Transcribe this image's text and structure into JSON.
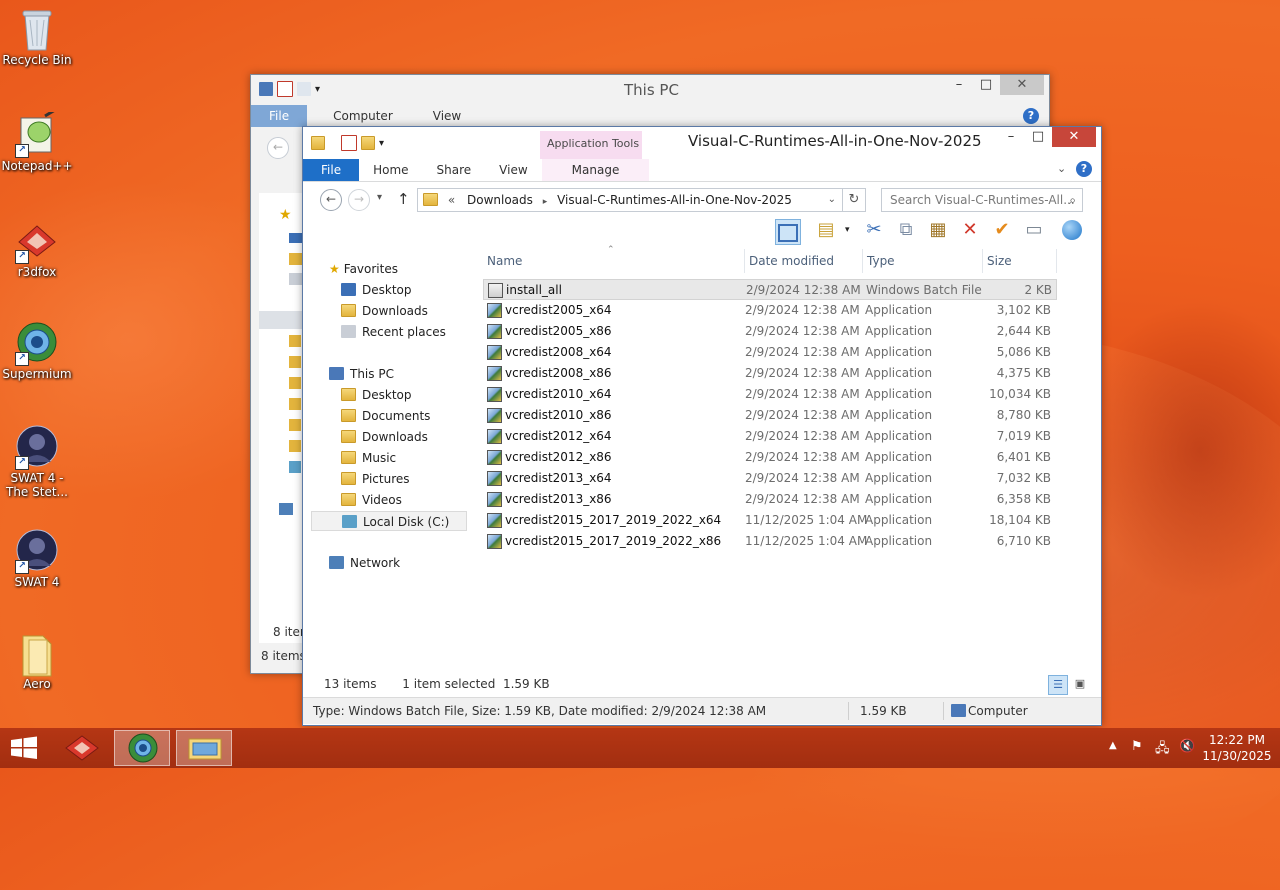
{
  "desktop": {
    "icons": [
      {
        "label": "Recycle Bin",
        "icon": "recycle-bin-icon"
      },
      {
        "label": "Notepad++",
        "icon": "notepad-plus-plus-icon"
      },
      {
        "label": "r3dfox",
        "icon": "r3dfox-icon"
      },
      {
        "label": "Supermium",
        "icon": "supermium-icon"
      },
      {
        "label": "SWAT 4 - The Stet...",
        "icon": "swat4-stetchkov-icon"
      },
      {
        "label": "SWAT 4",
        "icon": "swat4-icon"
      },
      {
        "label": "Aero",
        "icon": "folder-icon"
      }
    ]
  },
  "back_window": {
    "title": "This PC",
    "tabs": [
      "File",
      "Computer",
      "View"
    ],
    "status_items": "8 items",
    "status_items_2": "8 items"
  },
  "front_window": {
    "title": "Visual-C-Runtimes-All-in-One-Nov-2025",
    "contextual_group": "Application Tools",
    "tabs": [
      "File",
      "Home",
      "Share",
      "View",
      "Manage"
    ],
    "address": {
      "prefix": "«",
      "crumbs": [
        "Downloads",
        "Visual-C-Runtimes-All-in-One-Nov-2025"
      ]
    },
    "search_placeholder": "Search Visual-C-Runtimes-All...",
    "nav": {
      "favorites": "Favorites",
      "fav_items": [
        "Desktop",
        "Downloads",
        "Recent places"
      ],
      "this_pc": "This PC",
      "pc_items": [
        "Desktop",
        "Documents",
        "Downloads",
        "Music",
        "Pictures",
        "Videos",
        "Local Disk (C:)"
      ],
      "network": "Network"
    },
    "columns": {
      "name": "Name",
      "date": "Date modified",
      "type": "Type",
      "size": "Size"
    },
    "files": [
      {
        "name": "install_all",
        "date": "2/9/2024 12:38 AM",
        "type": "Windows Batch File",
        "size": "2 KB"
      },
      {
        "name": "vcredist2005_x64",
        "date": "2/9/2024 12:38 AM",
        "type": "Application",
        "size": "3,102 KB"
      },
      {
        "name": "vcredist2005_x86",
        "date": "2/9/2024 12:38 AM",
        "type": "Application",
        "size": "2,644 KB"
      },
      {
        "name": "vcredist2008_x64",
        "date": "2/9/2024 12:38 AM",
        "type": "Application",
        "size": "5,086 KB"
      },
      {
        "name": "vcredist2008_x86",
        "date": "2/9/2024 12:38 AM",
        "type": "Application",
        "size": "4,375 KB"
      },
      {
        "name": "vcredist2010_x64",
        "date": "2/9/2024 12:38 AM",
        "type": "Application",
        "size": "10,034 KB"
      },
      {
        "name": "vcredist2010_x86",
        "date": "2/9/2024 12:38 AM",
        "type": "Application",
        "size": "8,780 KB"
      },
      {
        "name": "vcredist2012_x64",
        "date": "2/9/2024 12:38 AM",
        "type": "Application",
        "size": "7,019 KB"
      },
      {
        "name": "vcredist2012_x86",
        "date": "2/9/2024 12:38 AM",
        "type": "Application",
        "size": "6,401 KB"
      },
      {
        "name": "vcredist2013_x64",
        "date": "2/9/2024 12:38 AM",
        "type": "Application",
        "size": "7,032 KB"
      },
      {
        "name": "vcredist2013_x86",
        "date": "2/9/2024 12:38 AM",
        "type": "Application",
        "size": "6,358 KB"
      },
      {
        "name": "vcredist2015_2017_2019_2022_x64",
        "date": "11/12/2025 1:04 AM",
        "type": "Application",
        "size": "18,104 KB"
      },
      {
        "name": "vcredist2015_2017_2019_2022_x86",
        "date": "11/12/2025 1:04 AM",
        "type": "Application",
        "size": "6,710 KB"
      }
    ],
    "selected_index": 0,
    "status": {
      "count": "13 items",
      "selection": "1 item selected  1.59 KB"
    },
    "details_bar": {
      "text": "Type: Windows Batch File, Size: 1.59 KB, Date modified: 2/9/2024 12:38 AM",
      "size": "1.59 KB",
      "location": "Computer"
    }
  },
  "taskbar": {
    "time": "12:22 PM",
    "date": "11/30/2025"
  },
  "colors": {
    "accent": "#1e6fc8",
    "close": "#c7463a",
    "taskbar": "#a22e10",
    "desktop": "#ee5f1f"
  }
}
